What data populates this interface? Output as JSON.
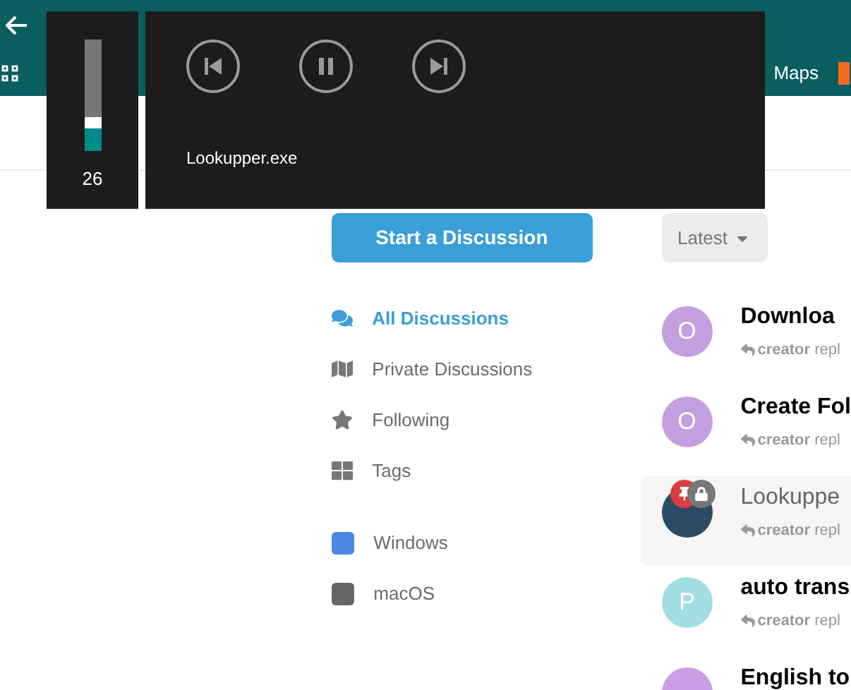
{
  "bookmarks": [
    {
      "label": "Maps"
    }
  ],
  "volume": {
    "level": 0.26,
    "reading": "26"
  },
  "media": {
    "playing": true,
    "app": "Lookupper.exe"
  },
  "start_button": "Start a Discussion",
  "nav": [
    {
      "label": "All Discussions",
      "kind": "discussions",
      "selected": true
    },
    {
      "label": "Private Discussions",
      "kind": "map",
      "selected": false
    },
    {
      "label": "Following",
      "kind": "star",
      "selected": false
    },
    {
      "label": "Tags",
      "kind": "tags",
      "selected": false
    }
  ],
  "tags": [
    {
      "label": "Windows",
      "color": "#4a86e8"
    },
    {
      "label": "macOS",
      "color": "#666666"
    }
  ],
  "sort": "Latest",
  "discussions": [
    {
      "avatar": "O",
      "kind": "letter",
      "color": "#c39fe0",
      "title": "Downloa",
      "meta": "**creator** repl",
      "highlighted": false,
      "pinned": false,
      "locked": false
    },
    {
      "avatar": "O",
      "kind": "letter",
      "color": "#c39fe0",
      "title": "Create Fol",
      "meta": "**creator** repl",
      "highlighted": false,
      "pinned": false,
      "locked": false
    },
    {
      "kind": "photo",
      "title": "Lookuppe",
      "meta": "**creator** repl",
      "highlighted": true,
      "pinned": true,
      "locked": true
    },
    {
      "avatar": "P",
      "kind": "letter",
      "color": "#a2dde4",
      "title": "auto trans",
      "meta": "**creator** repl",
      "highlighted": false,
      "pinned": false,
      "locked": false
    },
    {
      "kind": "letter",
      "color": "#c89fe6",
      "title": "English to",
      "highlighted": false,
      "pinned": false,
      "locked": false
    }
  ]
}
